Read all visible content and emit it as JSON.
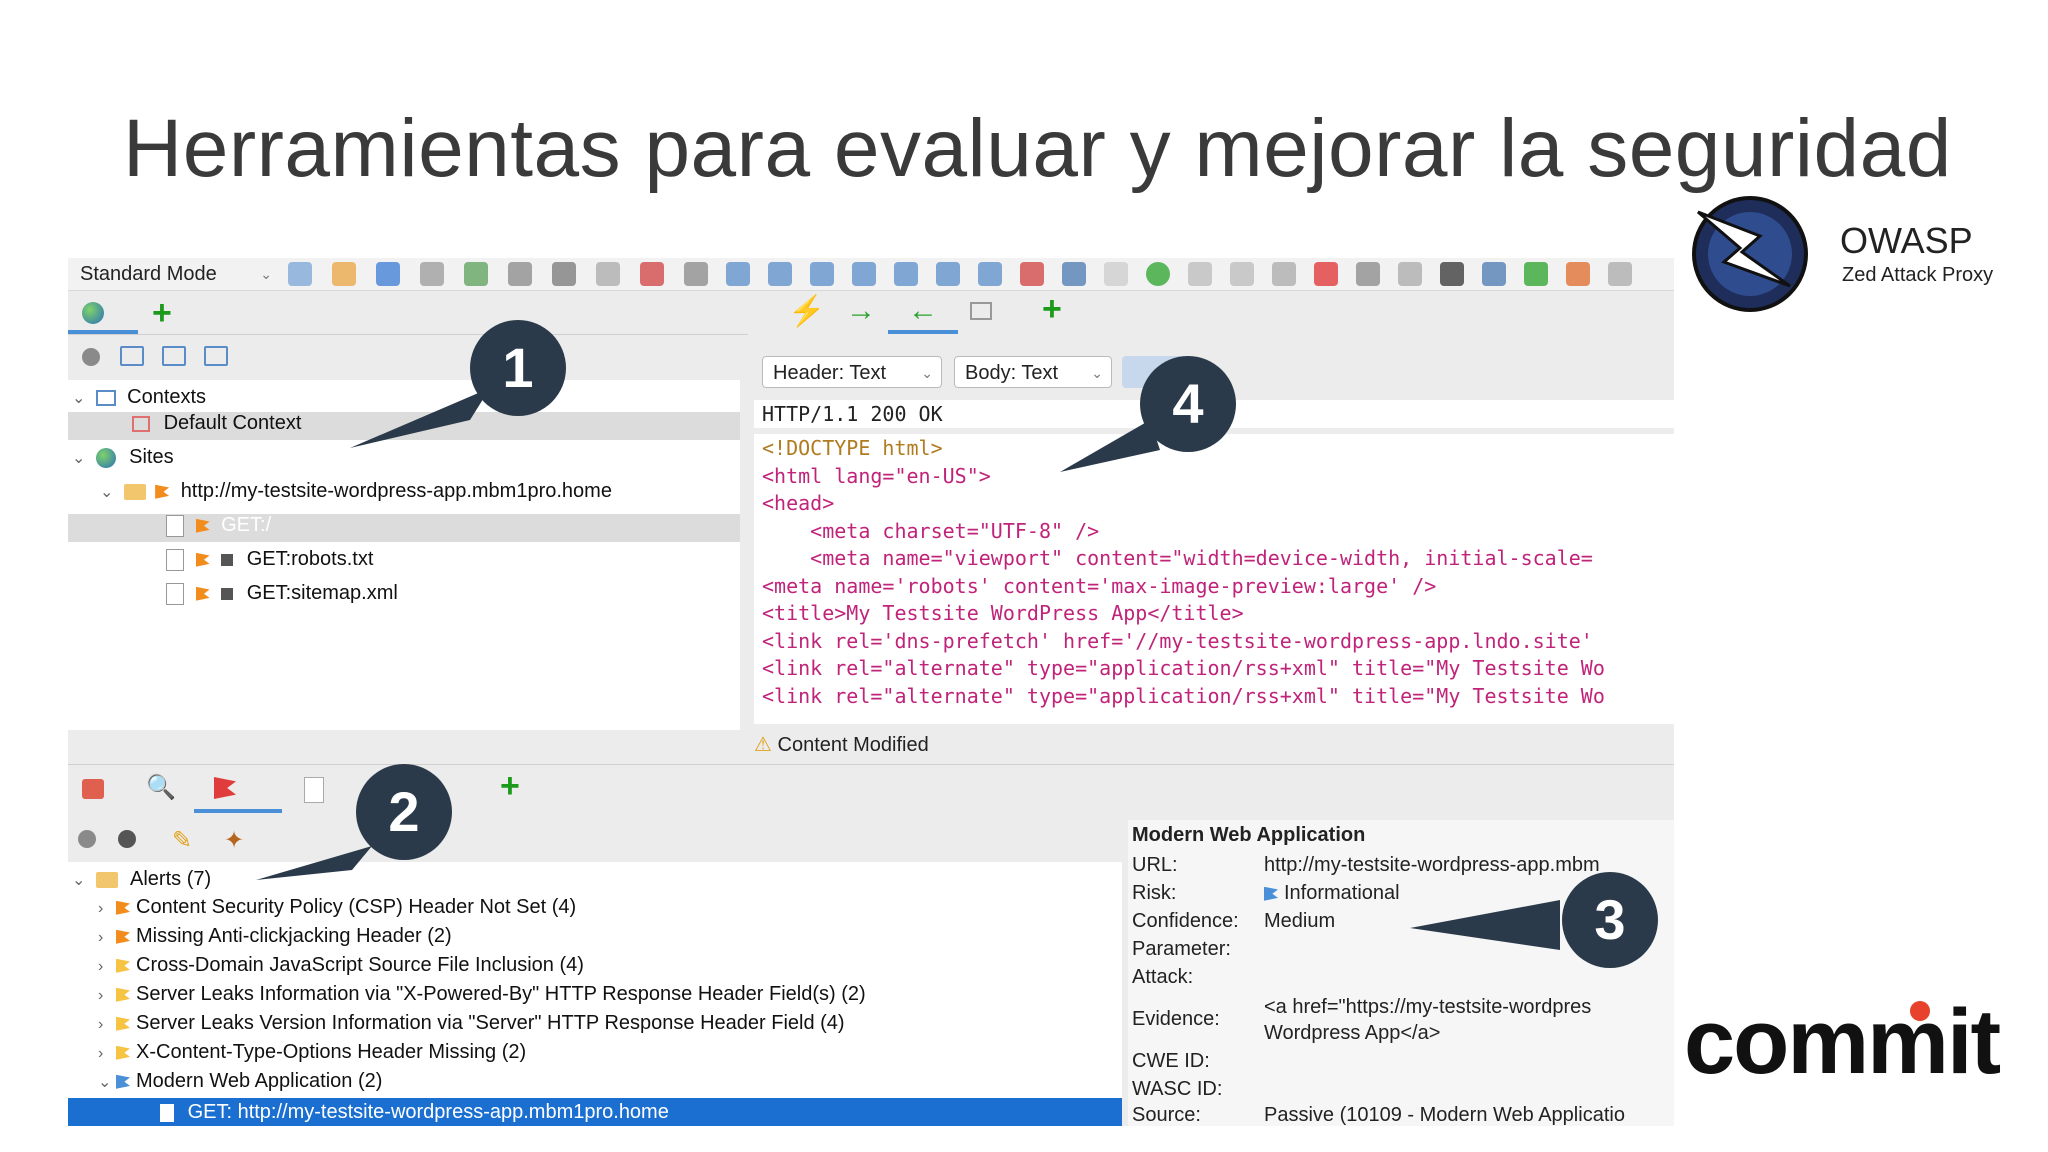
{
  "slide": {
    "title": "Herramientas para evaluar y mejorar la seguridad"
  },
  "owasp": {
    "name": "OWASP",
    "subtitle": "Zed Attack Proxy"
  },
  "commit": {
    "logo_text": "commit"
  },
  "toolbar": {
    "mode_selected": "Standard Mode"
  },
  "sites_tree": {
    "contexts_label": "Contexts",
    "default_context": "Default Context",
    "sites_label": "Sites",
    "site_url": "http://my-testsite-wordpress-app.mbm1pro.home",
    "nodes": [
      "GET:/",
      "GET:robots.txt",
      "GET:sitemap.xml"
    ]
  },
  "response": {
    "header_view": "Header: Text",
    "body_view": "Body: Text",
    "status_line": "HTTP/1.1 200 OK",
    "content_modified": "Content Modified",
    "body_lines": [
      "<!DOCTYPE html>",
      "<html lang=\"en-US\">",
      "<head>",
      "    <meta charset=\"UTF-8\" />",
      "    <meta name=\"viewport\" content=\"width=device-width, initial-scale=",
      "<meta name='robots' content='max-image-preview:large' />",
      "<title>My Testsite WordPress App</title>",
      "<link rel='dns-prefetch' href='//my-testsite-wordpress-app.lndo.site' ",
      "<link rel=\"alternate\" type=\"application/rss+xml\" title=\"My Testsite Wo",
      "<link rel=\"alternate\" type=\"application/rss+xml\" title=\"My Testsite Wo"
    ]
  },
  "alerts": {
    "root_label": "Alerts (7)",
    "items": [
      {
        "label": "Content Security Policy (CSP) Header Not Set (4)",
        "color": "#f28c1c"
      },
      {
        "label": "Missing Anti-clickjacking Header (2)",
        "color": "#f28c1c"
      },
      {
        "label": "Cross-Domain JavaScript Source File Inclusion (4)",
        "color": "#f6c343"
      },
      {
        "label": "Server Leaks Information via \"X-Powered-By\" HTTP Response Header Field(s) (2)",
        "color": "#f6c343"
      },
      {
        "label": "Server Leaks Version Information via \"Server\" HTTP Response Header Field (4)",
        "color": "#f6c343"
      },
      {
        "label": "X-Content-Type-Options Header Missing (2)",
        "color": "#f6c343"
      },
      {
        "label": "Modern Web Application (2)",
        "color": "#4a90d9"
      }
    ],
    "selected_child": "GET: http://my-testsite-wordpress-app.mbm1pro.home"
  },
  "alert_detail": {
    "title": "Modern Web Application",
    "url_label": "URL:",
    "url_value": "http://my-testsite-wordpress-app.mbm",
    "risk_label": "Risk:",
    "risk_value": "Informational",
    "confidence_label": "Confidence:",
    "confidence_value": "Medium",
    "parameter_label": "Parameter:",
    "attack_label": "Attack:",
    "evidence_label": "Evidence:",
    "evidence_value_1": "<a href=\"https://my-testsite-wordpres",
    "evidence_value_2": "Wordpress App</a>",
    "cwe_label": "CWE ID:",
    "wasc_label": "WASC ID:",
    "source_label": "Source:",
    "source_value": "Passive (10109 - Modern Web Applicatio"
  },
  "callouts": {
    "one": "1",
    "two": "2",
    "three": "3",
    "four": "4"
  }
}
